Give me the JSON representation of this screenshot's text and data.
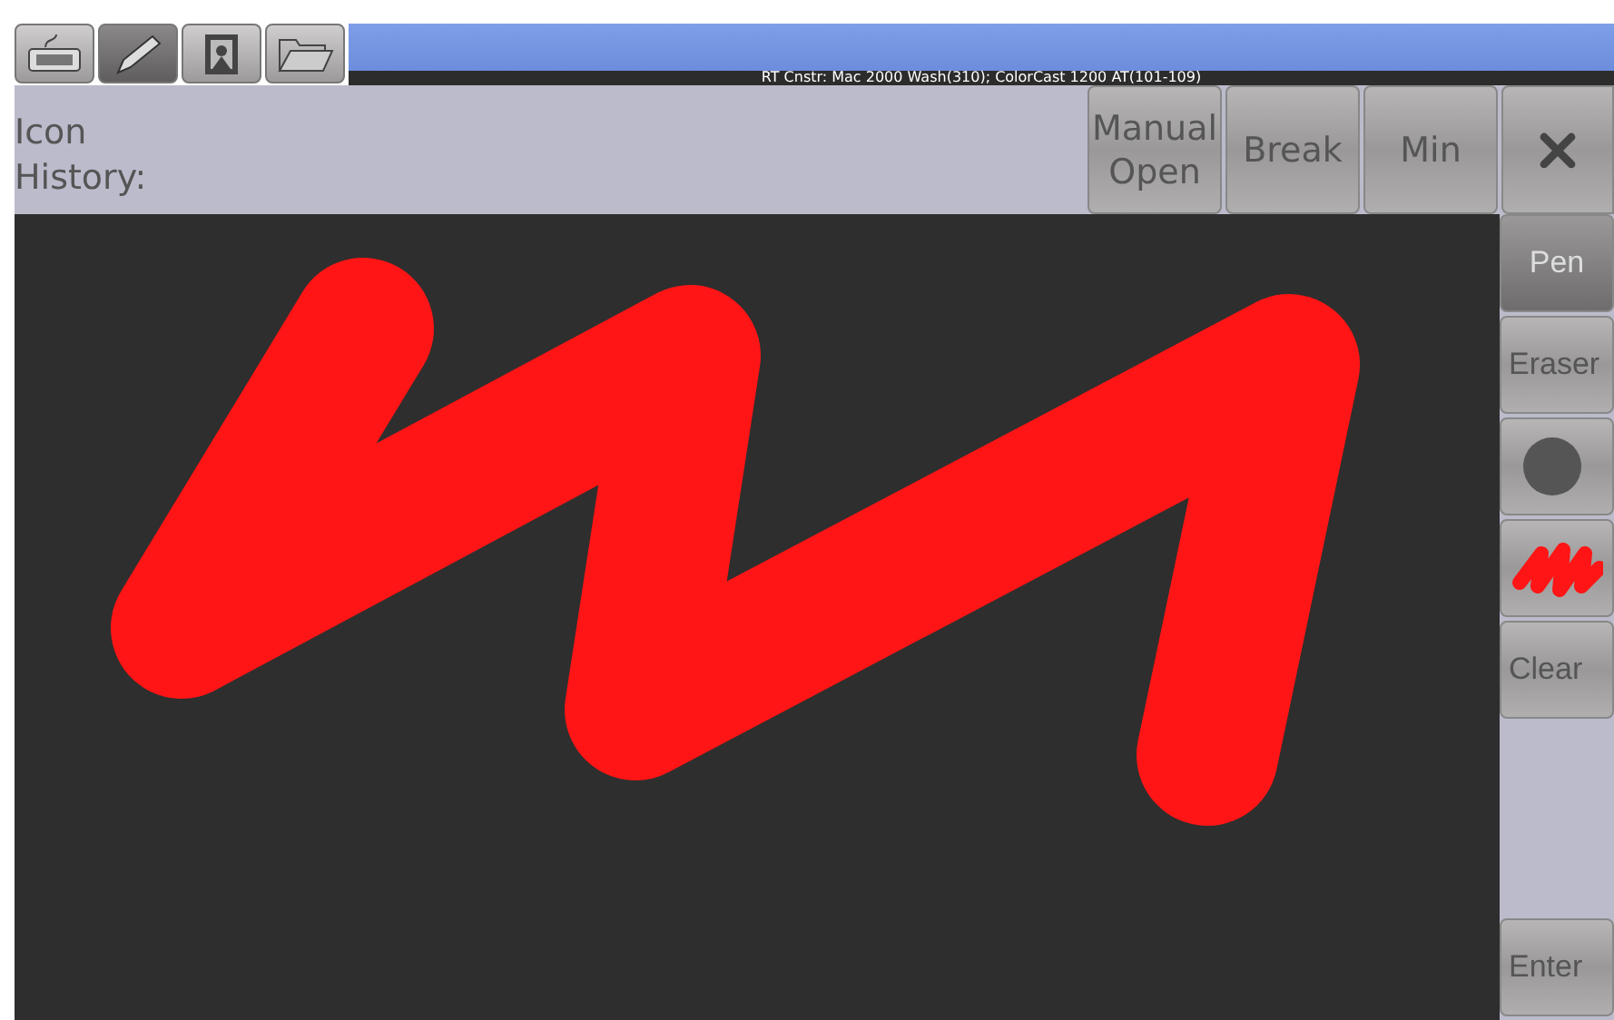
{
  "tabs": [
    {
      "kind": "keyboard",
      "selected": false
    },
    {
      "kind": "pencil",
      "selected": true
    },
    {
      "kind": "picture",
      "selected": false
    },
    {
      "kind": "folder",
      "selected": false
    }
  ],
  "status_text": "RT Cnstr: Mac 2000 Wash(310); ColorCast 1200 AT(101-109)",
  "header": {
    "label": "Icon History:",
    "buttons": [
      "Manual Open",
      "Break",
      "Min"
    ]
  },
  "tools": [
    {
      "kind": "text",
      "label": "Pen",
      "selected": true
    },
    {
      "kind": "text",
      "label": "Eraser",
      "selected": false
    },
    {
      "kind": "size"
    },
    {
      "kind": "color",
      "color": "#ff1515"
    },
    {
      "kind": "text",
      "label": "Clear"
    }
  ],
  "enter_button": "Enter"
}
